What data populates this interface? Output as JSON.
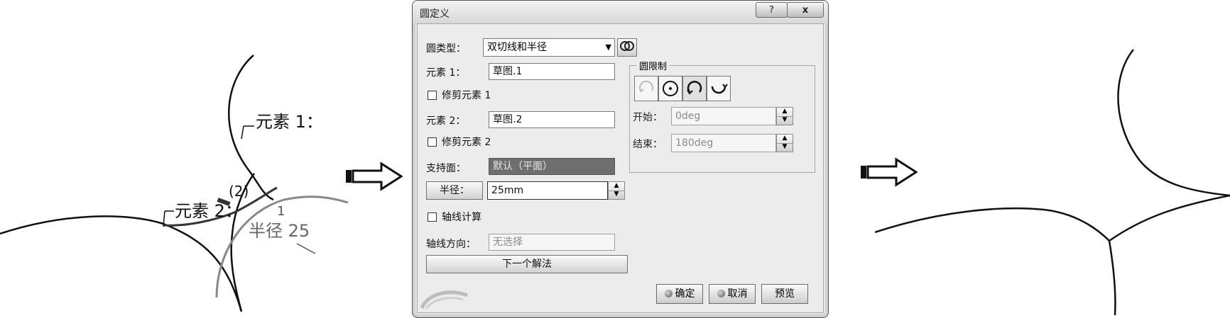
{
  "left_sketch": {
    "element1_label": "元素 1：",
    "element2_label": "元素 2：",
    "marker_num": "(2)",
    "marker_one": "1",
    "radius_label": "半径 25"
  },
  "dialog": {
    "title": "圆定义",
    "help_btn": "?",
    "close_btn": "x",
    "circle_type_label": "圆类型：",
    "circle_type_value": "双切线和半径",
    "element1_label": "元素 1：",
    "element1_value": "草图.1",
    "trim1_label": "修剪元素 1",
    "element2_label": "元素 2：",
    "element2_value": "草图.2",
    "trim2_label": "修剪元素 2",
    "support_label": "支持面：",
    "support_value": "默认（平面）",
    "radius_btn": "半径：",
    "radius_value": "25mm",
    "axis_calc_label": "轴线计算",
    "axis_dir_label": "轴线方向：",
    "axis_dir_placeholder": "无选择",
    "next_solution_btn": "下一个解法",
    "limits_group_title": "圆限制",
    "start_label": "开始：",
    "start_value": "0deg",
    "end_label": "结束：",
    "end_value": "180deg",
    "ok_btn": "确定",
    "cancel_btn": "取消",
    "preview_btn": "预览"
  }
}
